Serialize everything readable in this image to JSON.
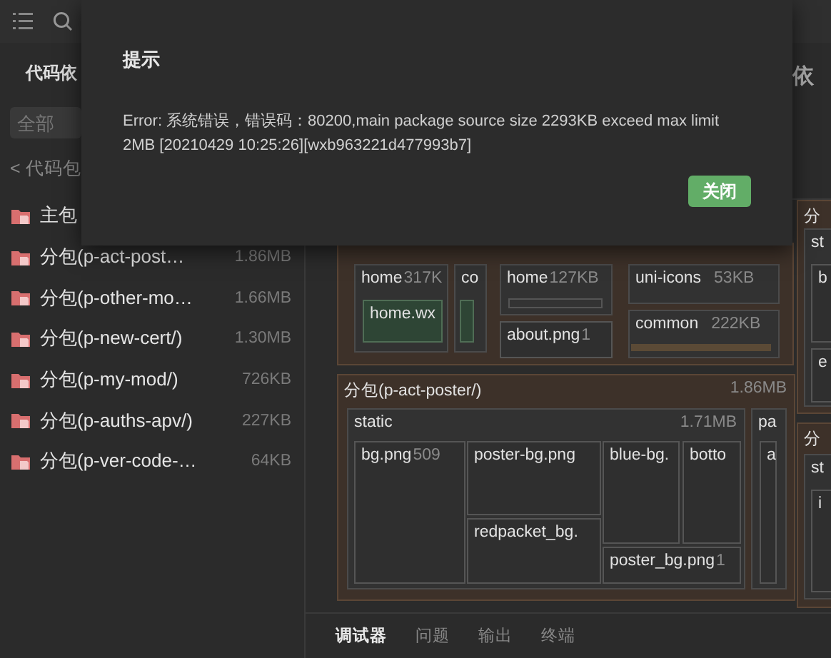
{
  "sidebar": {
    "title": "代码依",
    "filter": {
      "placeholder": "全部"
    },
    "back": "< 代码包",
    "packages": [
      {
        "name": "主包"
      },
      {
        "name": "分包(p-act-post…",
        "size": "1.86MB"
      },
      {
        "name": "分包(p-other-mo…",
        "size": "1.66MB"
      },
      {
        "name": "分包(p-new-cert/)",
        "size": "1.30MB"
      },
      {
        "name": "分包(p-my-mod/)",
        "size": "726KB"
      },
      {
        "name": "分包(p-auths-apv/)",
        "size": "227KB"
      },
      {
        "name": "分包(p-ver-code-…",
        "size": "64KB"
      }
    ]
  },
  "header": {
    "title": "依"
  },
  "treemap": {
    "nodes": [
      {
        "kind": "package"
      },
      {
        "kind": "folder",
        "label": "home",
        "size": "317K"
      },
      {
        "kind": "highlight",
        "label": "home.wx"
      },
      {
        "kind": "folder",
        "label": "co"
      },
      {
        "kind": "highlight"
      },
      {
        "kind": "folder",
        "label": "home",
        "size": "127KB"
      },
      {
        "kind": "bar"
      },
      {
        "kind": "file",
        "label": "about.png",
        "size": "1"
      },
      {
        "kind": "folder",
        "label": "uni-icons",
        "size": "53KB"
      },
      {
        "kind": "folder",
        "label": "common",
        "size": "222KB"
      },
      {
        "kind": "package",
        "label": "分包(p-act-poster/)",
        "size": "1.86MB"
      },
      {
        "kind": "folder",
        "label": "static",
        "size": "1.71MB"
      },
      {
        "kind": "file",
        "label": "bg.png",
        "size": "509"
      },
      {
        "kind": "file",
        "label": "poster-bg.png"
      },
      {
        "kind": "file",
        "label": "redpacket_bg."
      },
      {
        "kind": "file",
        "label": "blue-bg."
      },
      {
        "kind": "file",
        "label": "botto"
      },
      {
        "kind": "file",
        "label": "poster_bg.png",
        "size": "1"
      },
      {
        "kind": "folder",
        "label": "pa"
      },
      {
        "kind": "file",
        "label": "a"
      },
      {
        "kind": "package",
        "label": "分"
      },
      {
        "kind": "folder",
        "label": "st"
      },
      {
        "kind": "file",
        "label": "b"
      },
      {
        "kind": "file",
        "label": "e"
      },
      {
        "kind": "package",
        "label": "分"
      },
      {
        "kind": "folder",
        "label": "st"
      },
      {
        "kind": "file",
        "label": "i"
      }
    ]
  },
  "bottom_tabs": [
    {
      "label": "调试器",
      "selected": true
    },
    {
      "label": "问题",
      "selected": false
    },
    {
      "label": "输出",
      "selected": false
    },
    {
      "label": "终端",
      "selected": false
    }
  ],
  "dialog": {
    "title": "提示",
    "message": "Error: 系统错误，错误码：80200,main package source size 2293KB exceed max limit 2MB [20210429 10:25:26][wxb963221d477993b7]",
    "button": "关闭"
  }
}
